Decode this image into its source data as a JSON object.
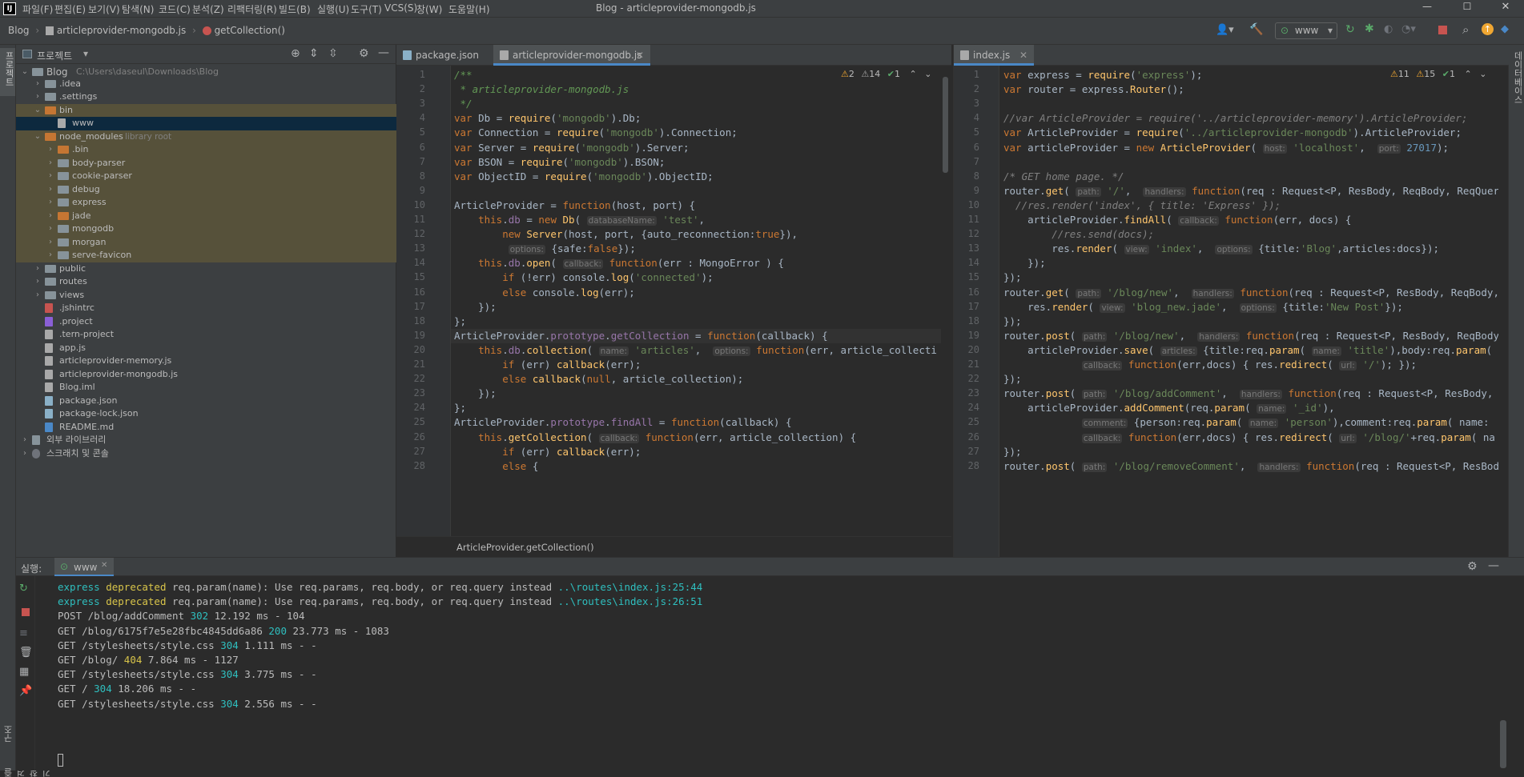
{
  "titlebar": {
    "menus": [
      "파일(F)",
      "편집(E)",
      "보기(V)",
      "탐색(N)",
      "코드(C)",
      "분석(Z)",
      "리팩터링(R)",
      "빌드(B)",
      "실행(U)",
      "도구(T)",
      "VCS(S)",
      "창(W)",
      "도움말(H)"
    ],
    "window_title": "Blog - articleprovider-mongodb.js"
  },
  "breadcrumb": [
    "Blog",
    "articleprovider-mongodb.js",
    "getCollection()"
  ],
  "toolbar": {
    "run_config": "www"
  },
  "project": {
    "header": "프로젝트",
    "root_name": "Blog",
    "root_path": "C:\\Users\\daseul\\Downloads\\Blog",
    "items": [
      {
        "name": ".idea",
        "type": "folder"
      },
      {
        "name": ".settings",
        "type": "folder"
      },
      {
        "name": "bin",
        "type": "folder-orange"
      },
      {
        "name": "www",
        "type": "file"
      },
      {
        "name": "node_modules",
        "type": "folder-orange",
        "note": "library root"
      },
      {
        "name": ".bin",
        "type": "folder-orange"
      },
      {
        "name": "body-parser",
        "type": "folder"
      },
      {
        "name": "cookie-parser",
        "type": "folder"
      },
      {
        "name": "debug",
        "type": "folder"
      },
      {
        "name": "express",
        "type": "folder"
      },
      {
        "name": "jade",
        "type": "folder-orange"
      },
      {
        "name": "mongodb",
        "type": "folder"
      },
      {
        "name": "morgan",
        "type": "folder"
      },
      {
        "name": "serve-favicon",
        "type": "folder"
      },
      {
        "name": "public",
        "type": "folder"
      },
      {
        "name": "routes",
        "type": "folder"
      },
      {
        "name": "views",
        "type": "folder"
      },
      {
        "name": ".jshintrc",
        "type": "file"
      },
      {
        "name": ".project",
        "type": "file"
      },
      {
        "name": ".tern-project",
        "type": "file"
      },
      {
        "name": "app.js",
        "type": "file"
      },
      {
        "name": "articleprovider-memory.js",
        "type": "file"
      },
      {
        "name": "articleprovider-mongodb.js",
        "type": "file"
      },
      {
        "name": "Blog.iml",
        "type": "file"
      },
      {
        "name": "package.json",
        "type": "file"
      },
      {
        "name": "package-lock.json",
        "type": "file"
      },
      {
        "name": "README.md",
        "type": "file"
      },
      {
        "name": "외부 라이브러리",
        "type": "lib"
      },
      {
        "name": "스크래치 및 콘솔",
        "type": "scratch"
      }
    ]
  },
  "editor1": {
    "tabs": [
      "package.json",
      "articleprovider-mongodb.js"
    ],
    "inspections": {
      "warn": "2",
      "weak": "14",
      "ok": "1"
    },
    "breadcrumb": "ArticleProvider.getCollection()",
    "lines": [
      "/**",
      " * articleprovider-mongodb.js",
      " */",
      "var Db = require('mongodb').Db;",
      "var Connection = require('mongodb').Connection;",
      "var Server = require('mongodb').Server;",
      "var BSON = require('mongodb').BSON;",
      "var ObjectID = require('mongodb').ObjectID;",
      "",
      "ArticleProvider = function(host, port) {",
      "    this.db = new Db( databaseName: 'test',",
      "        new Server(host, port, {auto_reconnection:true}),",
      "         options: {safe:false});",
      "    this.db.open( callback: function(err : MongoError ) {",
      "        if (!err) console.log('connected');",
      "        else console.log(err);",
      "    });",
      "};",
      "ArticleProvider.prototype.getCollection = function(callback) {",
      "    this.db.collection( name: 'articles',  options: function(err, article_collecti",
      "        if (err) callback(err);",
      "        else callback(null, article_collection);",
      "    });",
      "};",
      "ArticleProvider.prototype.findAll = function(callback) {",
      "    this.getCollection( callback: function(err, article_collection) {",
      "        if (err) callback(err);",
      "        else {"
    ]
  },
  "editor2": {
    "tabs": [
      "index.js"
    ],
    "inspections": {
      "warn": "11",
      "weak": "15",
      "ok": "1"
    },
    "lines": [
      "var express = require('express');",
      "var router = express.Router();",
      "",
      "//var ArticleProvider = require('../articleprovider-memory').ArticleProvider;",
      "var ArticleProvider = require('../articleprovider-mongodb').ArticleProvider;",
      "var articleProvider = new ArticleProvider( host: 'localhost',  port: 27017);",
      "",
      "/* GET home page. */",
      "router.get( path: '/',  handlers: function(req : Request<P, ResBody, ReqBody, ReqQuery, Locals>,",
      "  //res.render('index', { title: 'Express' });",
      "    articleProvider.findAll( callback: function(err, docs) {",
      "        //res.send(docs);",
      "        res.render( view: 'index',  options: {title:'Blog',articles:docs});",
      "    });",
      "});",
      "router.get( path: '/blog/new',  handlers: function(req : Request<P, ResBody, ReqBody, ReqQuery,",
      "    res.render( view: 'blog_new.jade',  options: {title:'New Post'});",
      "});",
      "router.post( path: '/blog/new',  handlers: function(req : Request<P, ResBody, ReqBody, ReqQuery",
      "    articleProvider.save( articles: {title:req.param( name: 'title'),body:req.param(",
      "             callback: function(err,docs) { res.redirect( url: '/'); });",
      "});",
      "router.post( path: '/blog/addComment',  handlers: function(req : Request<P, ResBody, ReqBody,",
      "    articleProvider.addComment(req.param( name: '_id'),",
      "             comment: {person:req.param( name: 'person'),comment:req.param( name:",
      "             callback: function(err,docs) { res.redirect( url: '/blog/'+req.param( na",
      "});",
      "router.post( path: '/blog/removeComment',  handlers: function(req : Request<P, ResBody, Req"
    ]
  },
  "run": {
    "label": "실행:",
    "tab": "www",
    "lines": [
      "express deprecated req.param(name): Use req.params, req.body, or req.query instead ..\\routes\\index.js:25:44",
      "express deprecated req.param(name): Use req.params, req.body, or req.query instead ..\\routes\\index.js:26:51",
      "POST /blog/addComment 302 12.192 ms - 104",
      "GET /blog/6175f7e5e28fbc4845dd6a86 200 23.773 ms - 1083",
      "GET /stylesheets/style.css 304 1.111 ms - -",
      "GET /blog/ 404 7.864 ms - 1127",
      "GET /stylesheets/style.css 304 3.775 ms - -",
      "GET / 304 18.206 ms - -",
      "GET /stylesheets/style.css 304 2.556 ms - -"
    ]
  },
  "side_tabs": {
    "left_top": "프로젝트",
    "left_bottom1": "구조",
    "left_bottom2": "즐겨찾기",
    "right_top": "데이터베이스"
  },
  "colors": {
    "keyword": "#cc7832",
    "string": "#6a8759",
    "comment": "#808080",
    "number": "#6897bb",
    "function": "#ffc66d",
    "accent": "#4a88c7"
  }
}
